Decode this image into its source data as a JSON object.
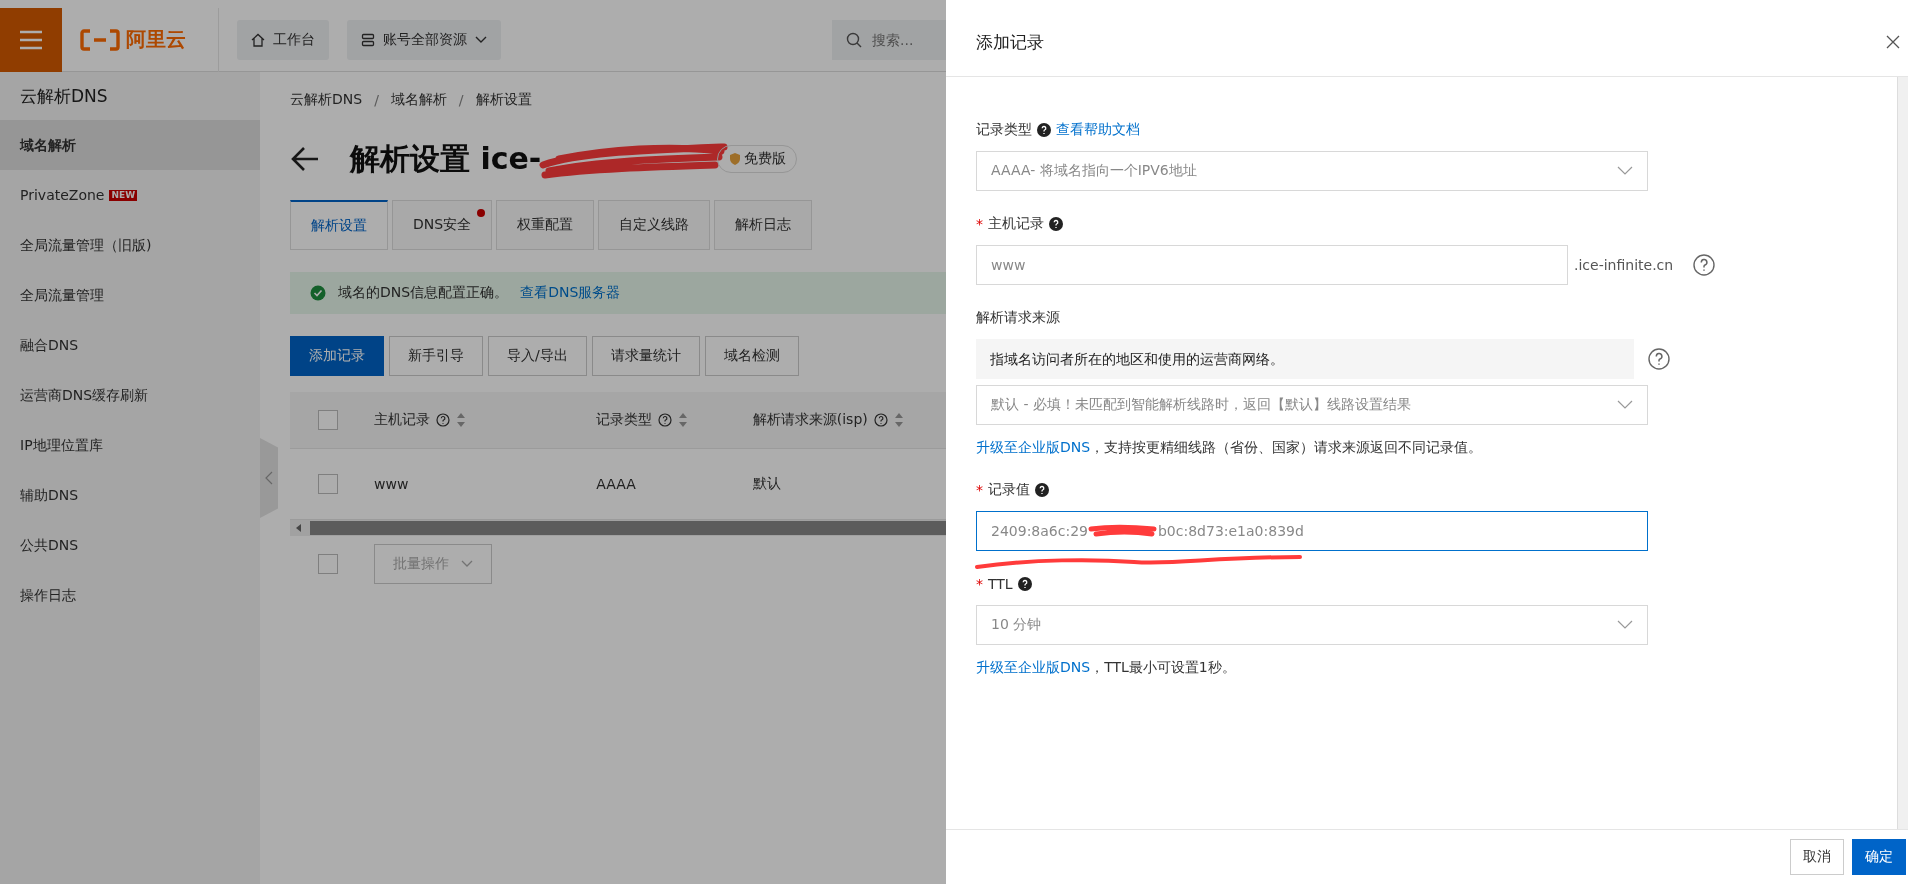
{
  "topbar": {
    "logo": "阿里云",
    "nav": [
      {
        "label": "工作台"
      },
      {
        "label": "账号全部资源"
      }
    ],
    "search": {
      "placeholder": "搜索..."
    }
  },
  "sidebar": {
    "title": "云解析DNS",
    "items": [
      {
        "label": "域名解析",
        "selected": true
      },
      {
        "label": "PrivateZone",
        "selected": false,
        "badge": "NEW"
      },
      {
        "label": "全局流量管理（旧版)",
        "selected": false
      },
      {
        "label": "全局流量管理",
        "selected": false
      },
      {
        "label": "融合DNS",
        "selected": false
      },
      {
        "label": "运营商DNS缓存刷新",
        "selected": false
      },
      {
        "label": "IP地理位置库",
        "selected": false
      },
      {
        "label": "辅助DNS",
        "selected": false
      },
      {
        "label": "公共DNS",
        "selected": false
      },
      {
        "label": "操作日志",
        "selected": false
      }
    ]
  },
  "breadcrumb": [
    {
      "label": "云解析DNS"
    },
    {
      "sep": "/",
      "label": "域名解析"
    },
    {
      "sep": "/",
      "label": "解析设置"
    }
  ],
  "page_title": "解析设置 ice-",
  "plan_badge": "免费版",
  "tabs": [
    {
      "label": "解析设置",
      "selected": true,
      "dot": false
    },
    {
      "label": "DNS安全",
      "selected": false,
      "dot": true
    },
    {
      "label": "权重配置",
      "selected": false,
      "dot": false
    },
    {
      "label": "自定义线路",
      "selected": false,
      "dot": false
    },
    {
      "label": "解析日志",
      "selected": false,
      "dot": false
    }
  ],
  "alert": {
    "text": "域名的DNS信息配置正确。",
    "link": "查看DNS服务器"
  },
  "actions": [
    {
      "label": "添加记录",
      "primary": true
    },
    {
      "label": "新手引导",
      "primary": false
    },
    {
      "label": "导入/导出",
      "primary": false
    },
    {
      "label": "请求量统计",
      "primary": false
    },
    {
      "label": "域名检测",
      "primary": false
    }
  ],
  "table": {
    "all_checked": false,
    "columns": [
      "主机记录",
      "记录类型",
      "解析请求来源(isp)"
    ],
    "rows": [
      {
        "cells": [
          "www",
          "AAAA",
          "默认"
        ],
        "checked": false
      }
    ],
    "footer_checked": false,
    "batch": "批量操作"
  },
  "drawer": {
    "title": "添加记录",
    "fields": [
      {
        "kind": "select",
        "label": "记录类型",
        "help": true,
        "link": "查看帮助文档",
        "value": "AAAA- 将域名指向一个IPV6地址"
      },
      {
        "kind": "input",
        "required_mark": "*",
        "label": "主机记录",
        "help": true,
        "value": "www",
        "suffix": ".ice-infinite.cn",
        "focused": false
      },
      {
        "kind": "select",
        "label": "解析请求来源",
        "help": false,
        "info": "指域名访问者所在的地区和使用的运营商网络。",
        "value": "默认 - 必填！未匹配到智能解析线路时，返回【默认】线路设置结果",
        "note_link": "升级至企业版DNS",
        "note": "，支持按更精细线路（省份、国家）请求来源返回不同记录值。"
      },
      {
        "kind": "input",
        "required_mark": "*",
        "label": "记录值",
        "help": true,
        "value": "2409:8a6c:29",
        "value_end": "b0c:8d73:e1a0:839d",
        "redacted": true,
        "focused": true
      },
      {
        "kind": "select",
        "required_mark": "*",
        "label": "TTL",
        "help": true,
        "value": "10 分钟",
        "note_link": "升级至企业版DNS",
        "note": "，TTL最小可设置1秒。"
      }
    ],
    "buttons": [
      {
        "label": "取消",
        "primary": false
      },
      {
        "label": "确定",
        "primary": true
      }
    ]
  }
}
